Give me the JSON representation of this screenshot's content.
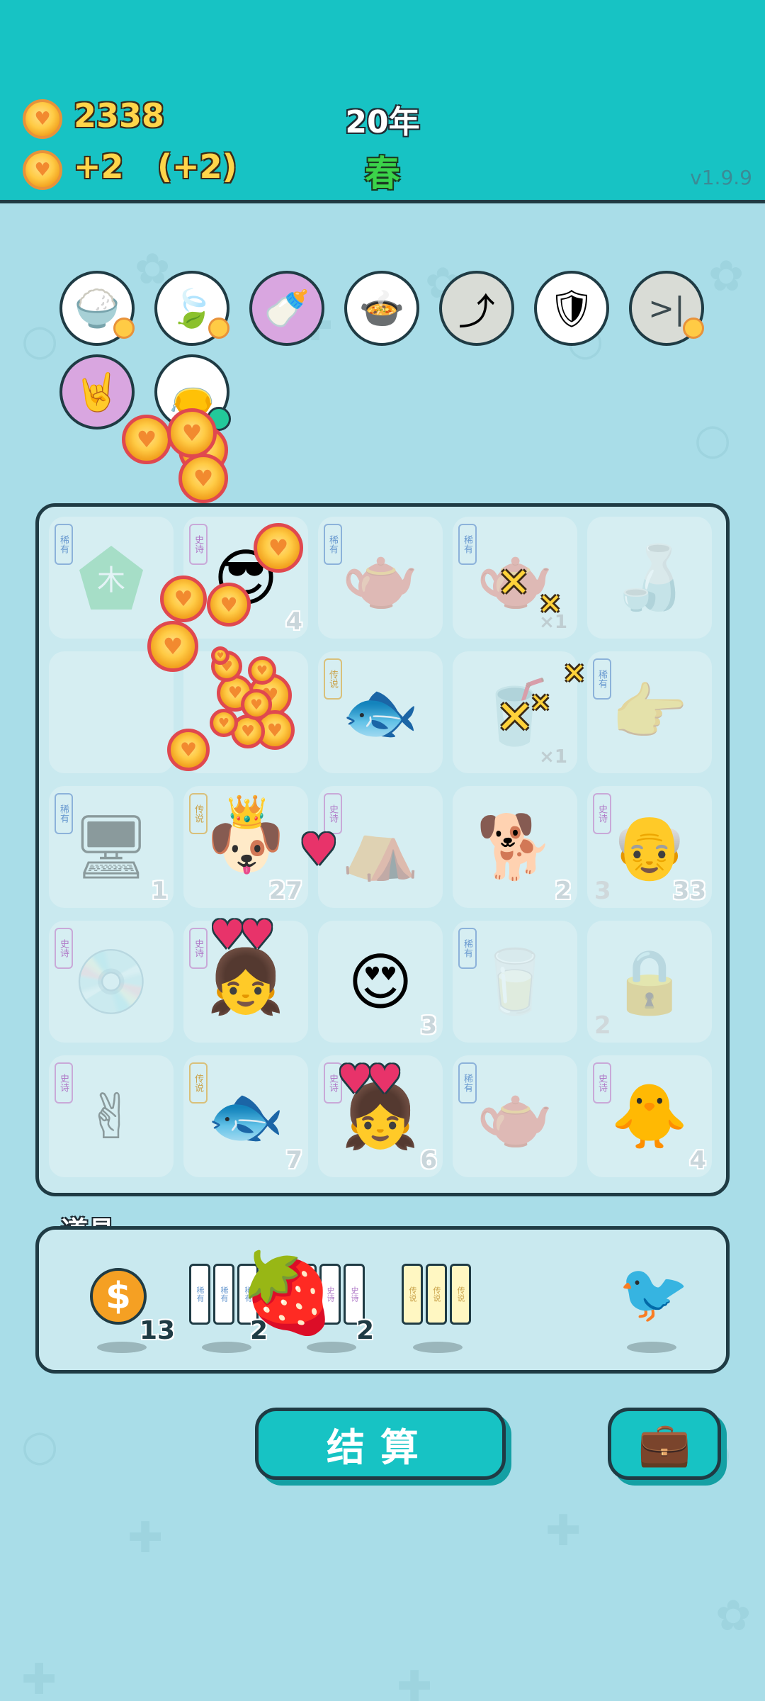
{
  "header": {
    "coins": "2338",
    "income": "+2",
    "income_bonus": "(+2)",
    "year": "20年",
    "season": "春",
    "version": "v1.9.9"
  },
  "buffs": [
    {
      "icon": "rice-bowl-icon",
      "glyph": "🍚",
      "color": "#ffffff"
    },
    {
      "icon": "leaf-icon",
      "glyph": "🍃",
      "color": "#ffffff"
    },
    {
      "icon": "breast-pump-icon",
      "glyph": "🍼",
      "color": "#d9a6e0"
    },
    {
      "icon": "duck-pot-icon",
      "glyph": "🍲",
      "color": "#ffffff"
    },
    {
      "icon": "upgrade-arrow-icon",
      "glyph": "⤴",
      "color": "#d9dcd6"
    },
    {
      "icon": "shield-wrench-icon",
      "glyph": "🛡",
      "color": "#ffffff"
    },
    {
      "icon": "skip-icon",
      "glyph": ">|",
      "color": "#d9dcd6"
    },
    {
      "icon": "rock-hand-icon",
      "glyph": "🤘",
      "color": "#d9a6e0"
    },
    {
      "icon": "sack-icon",
      "glyph": "👝",
      "color": "#ffffff"
    }
  ],
  "board": {
    "cells": [
      {
        "tag": "稀有",
        "tag_type": "blue",
        "icon": "wood-pentagon-icon",
        "glyph": "木",
        "dim": true,
        "count": "",
        "mult": ""
      },
      {
        "tag": "史诗",
        "tag_type": "purple",
        "icon": "sunglasses-guy-icon",
        "glyph": "😎",
        "dim": false,
        "count": "4",
        "mult": ""
      },
      {
        "tag": "稀有",
        "tag_type": "blue",
        "icon": "teapot-icon",
        "glyph": "🫖",
        "dim": true,
        "count": "",
        "mult": ""
      },
      {
        "tag": "稀有",
        "tag_type": "blue",
        "icon": "teapot-icon",
        "glyph": "🫖",
        "dim": true,
        "count": "",
        "mult": "×1"
      },
      {
        "tag": "",
        "tag_type": "blue",
        "icon": "milk-bottle-icon",
        "glyph": "🍶",
        "dim": true,
        "count": "",
        "mult": ""
      },
      {
        "tag": "",
        "tag_type": "blue",
        "icon": "empty-icon",
        "glyph": "",
        "dim": true,
        "count": "",
        "mult": ""
      },
      {
        "tag": "",
        "tag_type": "gold",
        "icon": "coin-pile-icon",
        "glyph": "",
        "dim": false,
        "count": "",
        "mult": ""
      },
      {
        "tag": "传说",
        "tag_type": "gold",
        "icon": "koi-fish-icon",
        "glyph": "🐟",
        "dim": false,
        "count": "",
        "mult": ""
      },
      {
        "tag": "",
        "tag_type": "blue",
        "icon": "bubble-tea-icon",
        "glyph": "🥤",
        "dim": true,
        "count": "",
        "mult": "×1"
      },
      {
        "tag": "稀有",
        "tag_type": "blue",
        "icon": "pointing-hand-icon",
        "glyph": "👉",
        "dim": true,
        "count": "",
        "mult": ""
      },
      {
        "tag": "稀有",
        "tag_type": "blue",
        "icon": "pc-tower-icon",
        "glyph": "🖥",
        "dim": true,
        "count": "1",
        "mult": ""
      },
      {
        "tag": "传说",
        "tag_type": "gold",
        "icon": "crowned-husky-icon",
        "glyph": "🐶",
        "dim": false,
        "count": "27",
        "mult": ""
      },
      {
        "tag": "史诗",
        "tag_type": "purple",
        "icon": "rabbit-tent-icon",
        "glyph": "⛺",
        "dim": true,
        "count": "",
        "mult": ""
      },
      {
        "tag": "",
        "tag_type": "blue",
        "icon": "husky-dog-icon",
        "glyph": "🐕",
        "dim": false,
        "count": "2",
        "mult": ""
      },
      {
        "tag": "史诗",
        "tag_type": "purple",
        "icon": "grandpa-icon",
        "glyph": "👴",
        "dim": false,
        "count": "33",
        "count_left": "3",
        "mult": ""
      },
      {
        "tag": "史诗",
        "tag_type": "purple",
        "icon": "cpu-cooler-icon",
        "glyph": "💿",
        "dim": true,
        "count": "",
        "mult": ""
      },
      {
        "tag": "史诗",
        "tag_type": "purple",
        "icon": "braided-girl-icon",
        "glyph": "👧",
        "dim": false,
        "count": "",
        "mult": ""
      },
      {
        "tag": "",
        "tag_type": "blue",
        "icon": "bald-man-heart-glasses-icon",
        "glyph": "😍",
        "dim": false,
        "count": "3",
        "mult": ""
      },
      {
        "tag": "稀有",
        "tag_type": "blue",
        "icon": "glass-cup-icon",
        "glyph": "🥛",
        "dim": true,
        "count": "",
        "mult": ""
      },
      {
        "tag": "",
        "tag_type": "blue",
        "icon": "safe-box-icon",
        "glyph": "🔒",
        "dim": true,
        "count": "",
        "count_left": "2",
        "mult": ""
      },
      {
        "tag": "史诗",
        "tag_type": "purple",
        "icon": "peace-hand-icon",
        "glyph": "✌",
        "dim": true,
        "count": "",
        "mult": ""
      },
      {
        "tag": "传说",
        "tag_type": "gold",
        "icon": "koi-fish-icon",
        "glyph": "🐟",
        "dim": false,
        "count": "7",
        "mult": ""
      },
      {
        "tag": "史诗",
        "tag_type": "purple",
        "icon": "braided-girl-glow-icon",
        "glyph": "👧",
        "dim": false,
        "count": "6",
        "mult": ""
      },
      {
        "tag": "稀有",
        "tag_type": "blue",
        "icon": "teapot-icon",
        "glyph": "🫖",
        "dim": true,
        "count": "",
        "mult": ""
      },
      {
        "tag": "史诗",
        "tag_type": "purple",
        "icon": "yellow-chick-face-icon",
        "glyph": "🐥",
        "dim": false,
        "count": "4",
        "mult": ""
      }
    ]
  },
  "items": {
    "title": "道具",
    "list": [
      {
        "icon": "dollar-coin-icon",
        "count": "13"
      },
      {
        "icon": "rare-cards-icon",
        "labels": [
          "稀有",
          "稀有",
          "稀有"
        ],
        "count": "2"
      },
      {
        "icon": "epic-cards-icon",
        "labels": [
          "史诗",
          "史诗",
          "史诗"
        ],
        "count": "2"
      },
      {
        "icon": "legend-cards-icon",
        "labels": [
          "传说",
          "传说",
          "传说"
        ],
        "count": ""
      },
      {
        "icon": "white-bird-icon",
        "count": ""
      }
    ],
    "floating": "strawberry-icon"
  },
  "buttons": {
    "settle": "结算",
    "bag": "briefcase-icon"
  },
  "colors": {
    "header": "#17c3c4",
    "background": "#a9dde8",
    "outline": "#1f3b44",
    "coin": "#ffcb45"
  }
}
